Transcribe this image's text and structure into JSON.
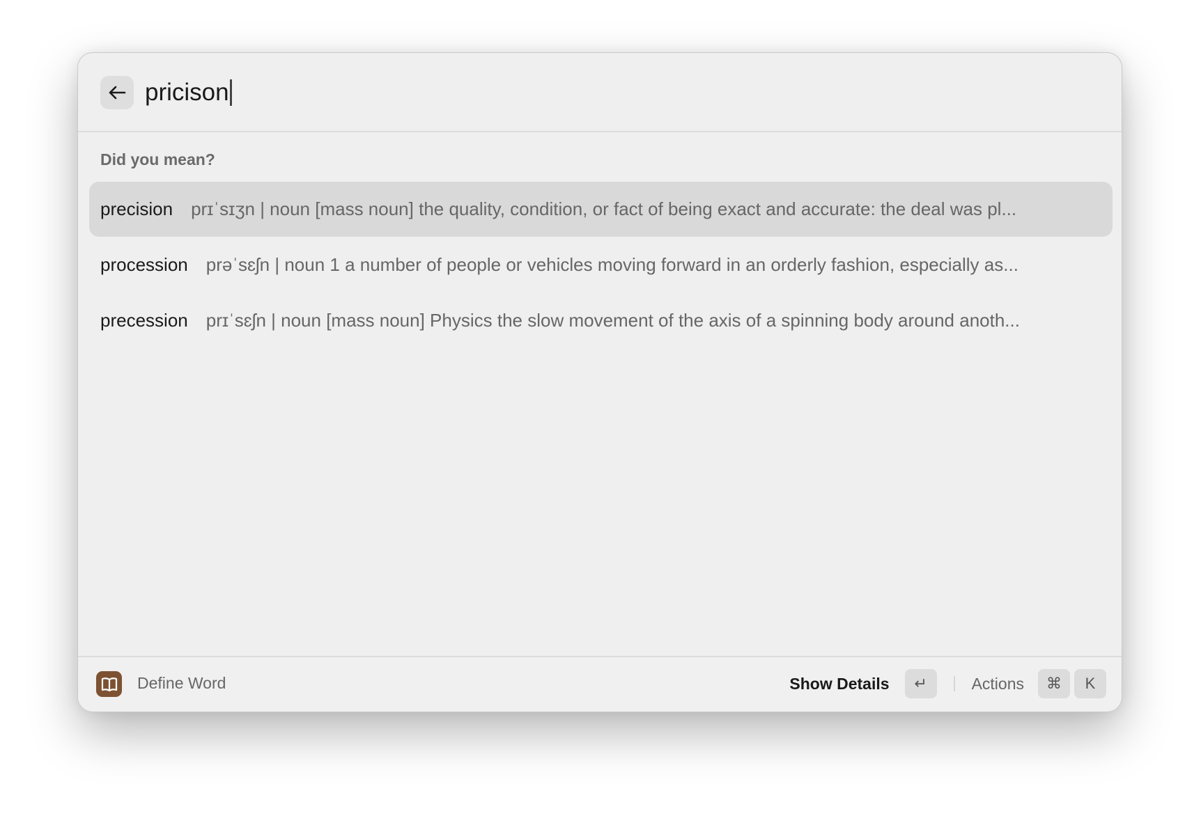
{
  "search": {
    "value": "pricison",
    "back_icon": "arrow-left-icon"
  },
  "section_title": "Did you mean?",
  "suggestions": [
    {
      "word": "precision",
      "definition": "prɪˈsɪʒn | noun [mass noun] the quality, condition, or fact of being exact and accurate: the deal was pl...",
      "selected": true
    },
    {
      "word": "procession",
      "definition": "prəˈsɛʃn | noun 1 a number of people or vehicles moving forward in an orderly fashion, especially as...",
      "selected": false
    },
    {
      "word": "precession",
      "definition": "prɪˈsɛʃn | noun [mass noun] Physics the slow movement of the axis of a spinning body around anoth...",
      "selected": false
    }
  ],
  "footer": {
    "app_icon": "book-icon",
    "app_name": "Define Word",
    "primary_action": "Show Details",
    "primary_key": "↵",
    "actions_label": "Actions",
    "actions_keys": [
      "⌘",
      "K"
    ]
  },
  "colors": {
    "window_bg": "#efefef",
    "selected_row": "#d9d9d9",
    "app_icon_bg": "#7d5232"
  }
}
